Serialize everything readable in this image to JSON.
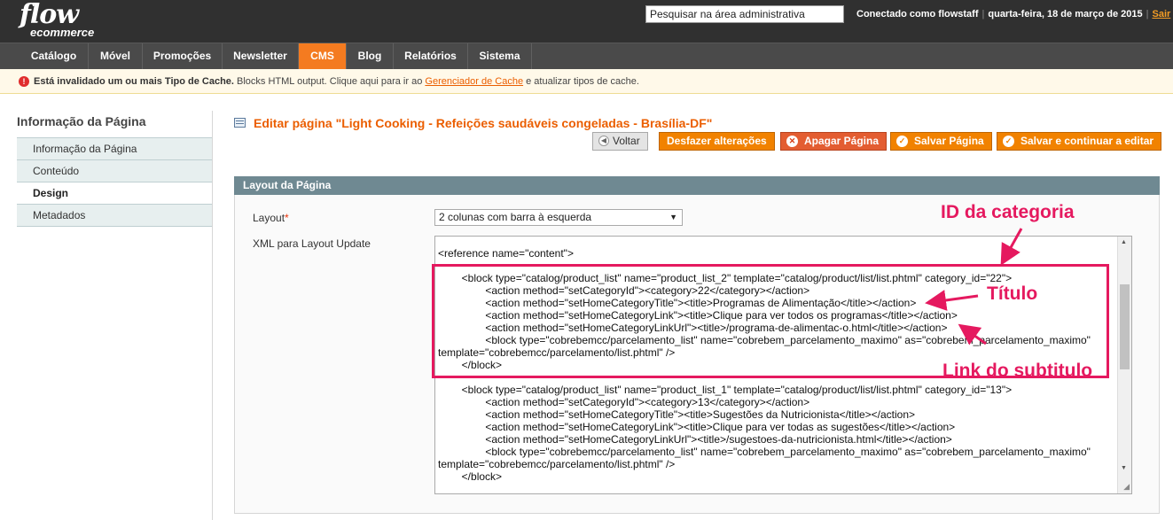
{
  "header": {
    "logo_main": "flow",
    "logo_sub": "ecommerce",
    "search_placeholder": "Pesquisar na área administrativa",
    "logged_in_as": "Conectado como flowstaff",
    "date": "quarta-feira, 18 de março de 2015",
    "logout_label": "Sair"
  },
  "nav": {
    "items": [
      {
        "label": "Catálogo"
      },
      {
        "label": "Móvel"
      },
      {
        "label": "Promoções"
      },
      {
        "label": "Newsletter"
      },
      {
        "label": "CMS"
      },
      {
        "label": "Blog"
      },
      {
        "label": "Relatórios"
      },
      {
        "label": "Sistema"
      }
    ],
    "active": "CMS"
  },
  "notice": {
    "bold_text": "Está invalidado um ou mais Tipo de Cache.",
    "text_before_link": " Blocks HTML output. Clique aqui para ir ao ",
    "link_text": "Gerenciador de Cache",
    "text_after_link": " e atualizar tipos de cache."
  },
  "sidebar": {
    "title": "Informação da Página",
    "items": [
      {
        "label": "Informação da Página"
      },
      {
        "label": "Conteúdo"
      },
      {
        "label": "Design"
      },
      {
        "label": "Metadados"
      }
    ],
    "active": "Design"
  },
  "page": {
    "title": "Editar página \"Light Cooking - Refeições saudáveis congeladas - Brasília-DF\"",
    "buttons": {
      "back": "Voltar",
      "reset": "Desfazer alterações",
      "delete": "Apagar Página",
      "save": "Salvar Página",
      "save_continue": "Salvar e continuar a editar"
    }
  },
  "layout_section": {
    "title": "Layout da Página",
    "layout_label": "Layout",
    "layout_required": "*",
    "layout_value": "2 colunas com barra à esquerda",
    "xml_label": "XML para Layout Update",
    "xml_lines": [
      "<reference name=\"content\">",
      "",
      "        <block type=\"catalog/product_list\" name=\"product_list_2\" template=\"catalog/product/list/list.phtml\" category_id=\"22\">",
      "                <action method=\"setCategoryId\"><category>22</category></action>",
      "                <action method=\"setHomeCategoryTitle\"><title>Programas de Alimentação</title></action>",
      "                <action method=\"setHomeCategoryLink\"><title>Clique para ver todos os programas</title></action>",
      "                <action method=\"setHomeCategoryLinkUrl\"><title>/programa-de-alimentac-o.html</title></action>",
      "                <block type=\"cobrebemcc/parcelamento_list\" name=\"cobrebem_parcelamento_maximo\" as=\"cobrebem_parcelamento_maximo\"",
      "template=\"cobrebemcc/parcelamento/list.phtml\" />",
      "        </block>",
      "",
      "        <block type=\"catalog/product_list\" name=\"product_list_1\" template=\"catalog/product/list/list.phtml\" category_id=\"13\">",
      "                <action method=\"setCategoryId\"><category>13</category></action>",
      "                <action method=\"setHomeCategoryTitle\"><title>Sugestões da Nutricionista</title></action>",
      "                <action method=\"setHomeCategoryLink\"><title>Clique para ver todas as sugestões</title></action>",
      "                <action method=\"setHomeCategoryLinkUrl\"><title>/sugestoes-da-nutricionista.html</title></action>",
      "                <block type=\"cobrebemcc/parcelamento_list\" name=\"cobrebem_parcelamento_maximo\" as=\"cobrebem_parcelamento_maximo\"",
      "template=\"cobrebemcc/parcelamento/list.phtml\" />",
      "        </block>"
    ]
  },
  "annotations": {
    "category_id": "ID da categoria",
    "title": "Título",
    "subtitle_link": "Link do subtitulo",
    "color": "#e5195f"
  },
  "colors": {
    "header_bg": "#303030",
    "nav_bg": "#4a4a4a",
    "accent": "#f47b20",
    "section_head": "#6f8992"
  }
}
